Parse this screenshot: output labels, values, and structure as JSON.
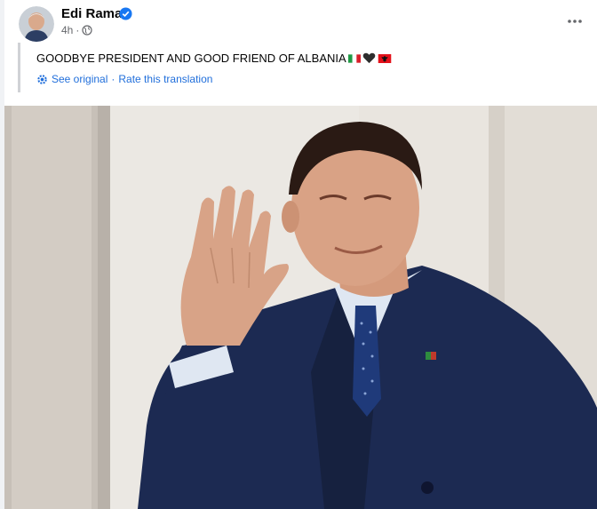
{
  "post": {
    "author": "Edi Rama",
    "time": "4h",
    "separator": "·",
    "text": "GOODBYE PRESIDENT AND GOOD FRIEND OF ALBANIA",
    "emojis": [
      "italy-flag",
      "black-heart",
      "albania-flag"
    ],
    "see_original": "See original",
    "dot": "·",
    "rate_translation": "Rate this translation"
  },
  "icons": {
    "verified": "verified-badge-icon",
    "privacy": "globe-icon",
    "more": "more-options-icon",
    "translate": "gear-translate-icon"
  },
  "colors": {
    "link": "#216fdb",
    "verified": "#1877f2",
    "suit": "#1c2a52"
  }
}
